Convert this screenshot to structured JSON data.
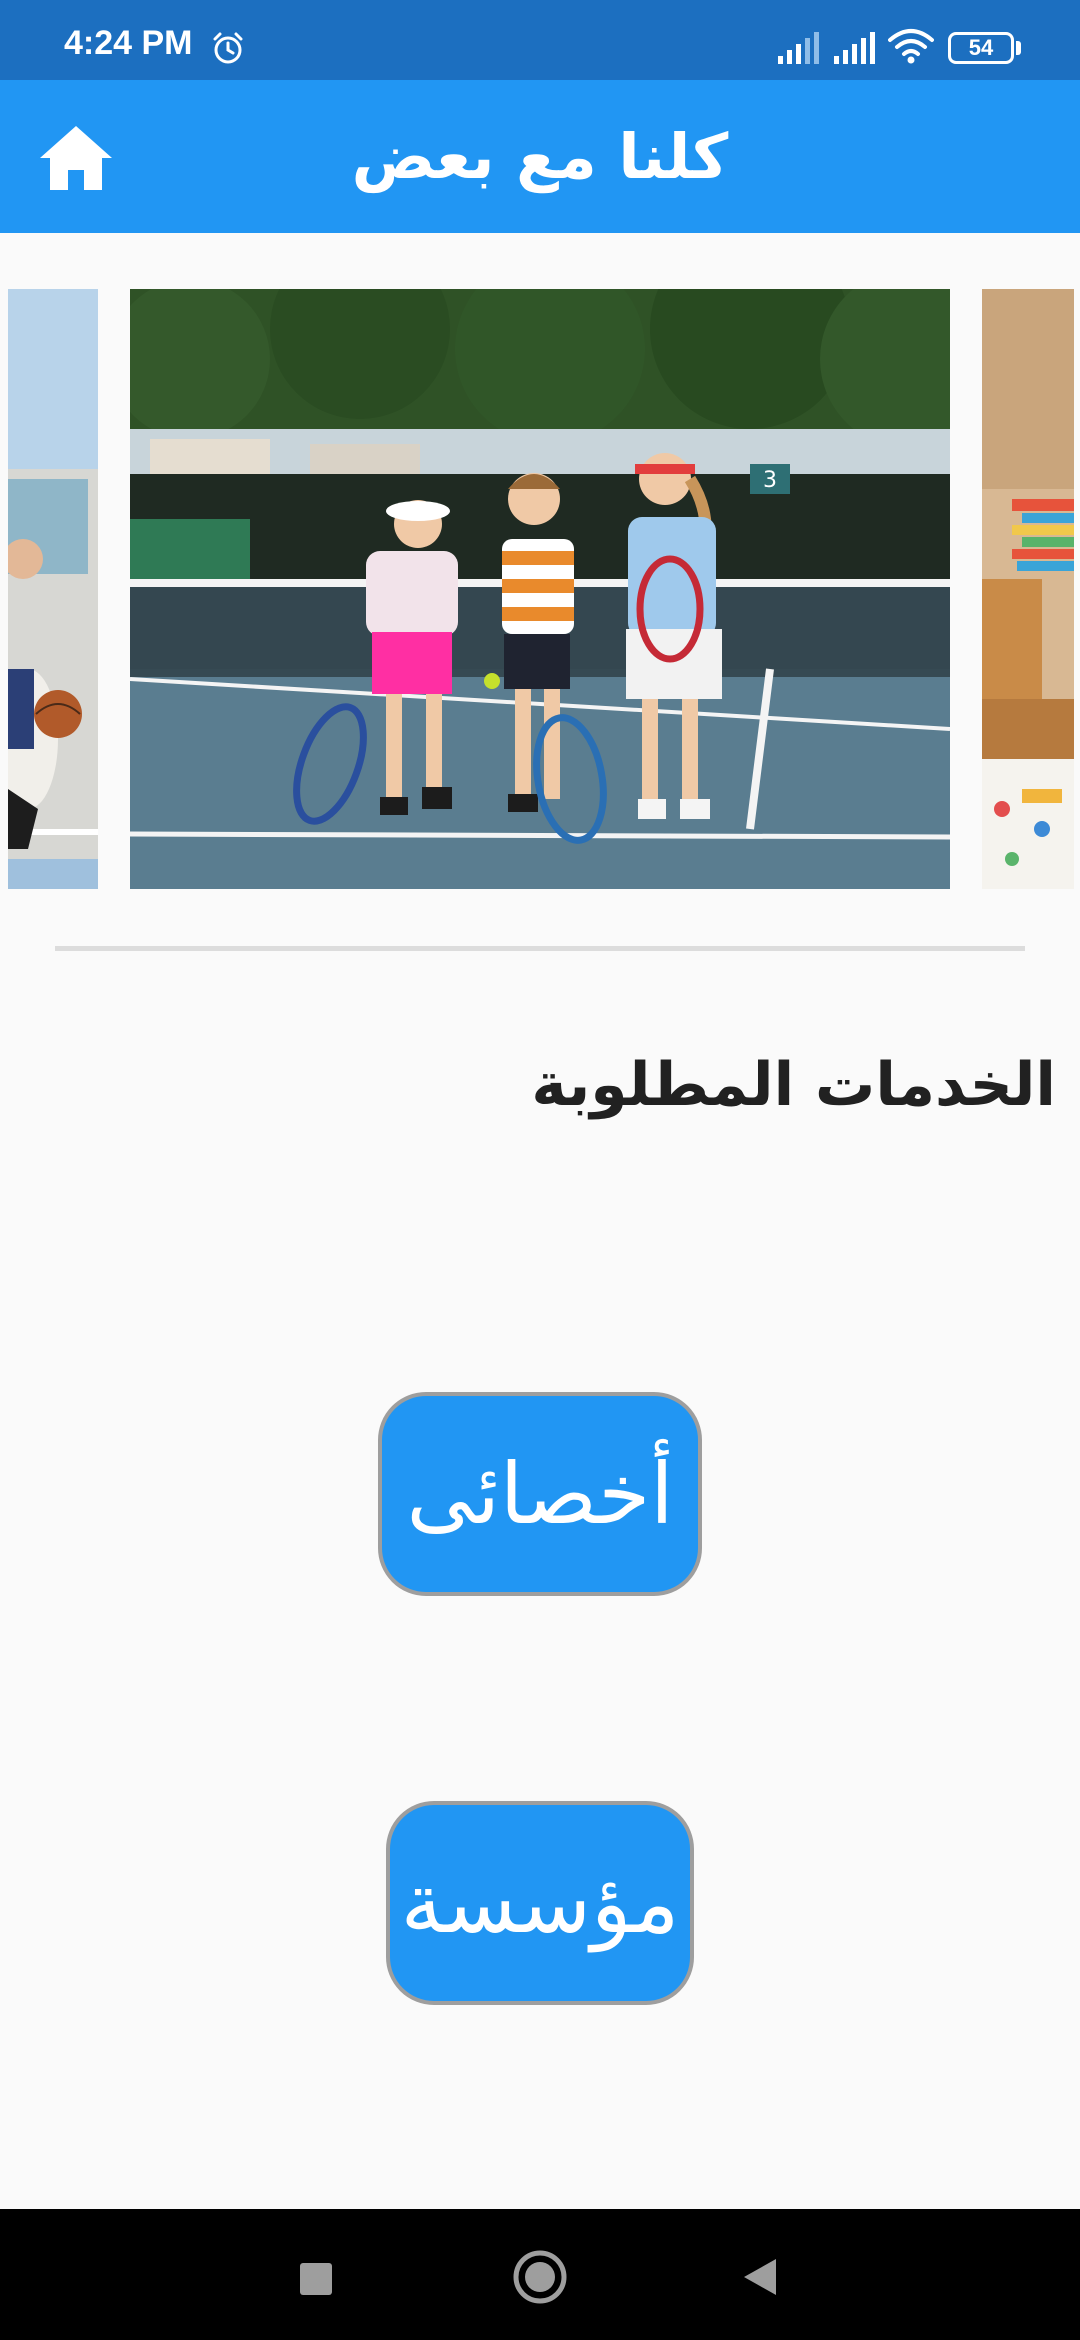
{
  "status_bar": {
    "time": "4:24 PM",
    "battery": "54",
    "icons": [
      "alarm-icon",
      "signal-icon",
      "signal-icon",
      "wifi-icon",
      "battery-icon"
    ]
  },
  "app_bar": {
    "title": "كلنا مع بعض",
    "home_icon": "home-icon",
    "color": "#2196f3"
  },
  "carousel": {
    "slides": [
      "basketball-photo",
      "children-tennis-photo",
      "classroom-photo"
    ]
  },
  "section": {
    "title": "الخدمات المطلوبة"
  },
  "buttons": {
    "specialist": "أخصائى",
    "institution": "مؤسسة"
  },
  "nav_bar": {
    "icons": [
      "recent-apps-icon",
      "home-circle-icon",
      "back-icon"
    ]
  },
  "colors": {
    "status_bar": "#1c6fc0",
    "primary": "#2196f3",
    "background": "#fafafa"
  }
}
